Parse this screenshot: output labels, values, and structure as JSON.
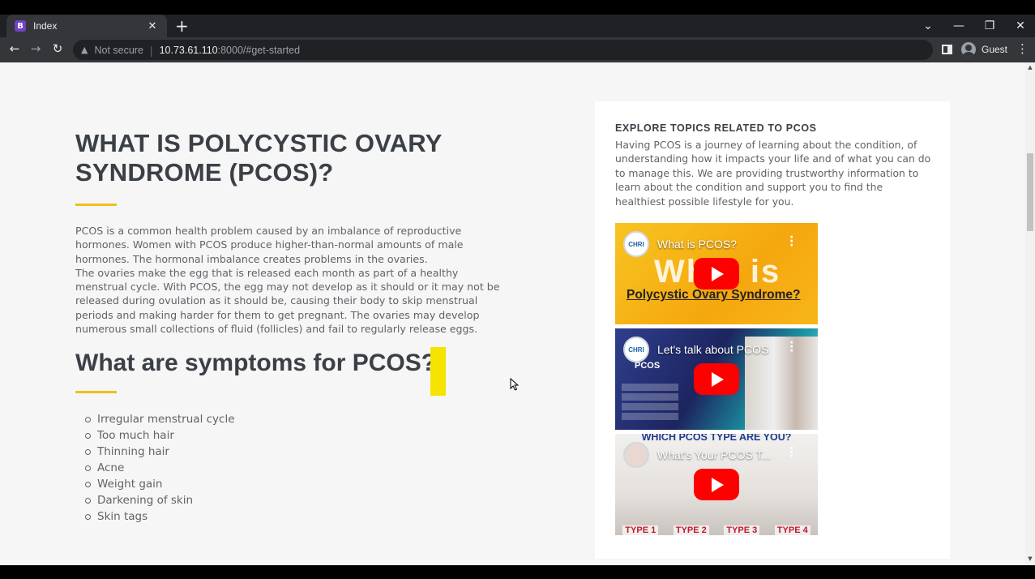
{
  "browser": {
    "tab_favicon": "B",
    "tab_title": "Index",
    "tab_close": "✕",
    "new_tab": "+",
    "security_label": "Not secure",
    "url_host": "10.73.61.110",
    "url_rest": ":8000/#get-started",
    "profile_name": "Guest",
    "icons": [
      "back-icon",
      "forward-icon",
      "reload-icon",
      "warning-icon",
      "side-panel-icon",
      "menu-icon",
      "tab-search-icon",
      "minimize-icon",
      "restore-icon",
      "close-icon"
    ]
  },
  "main": {
    "heading": "WHAT IS POLYCYSTIC OVARY SYNDROME (PCOS)?",
    "intro_p1": "PCOS is a common health problem caused by an imbalance of reproductive hormones. Women with PCOS produce higher-than-normal amounts of male hormones. The hormonal imbalance creates problems in the ovaries.",
    "intro_p2": "The ovaries make the egg that is released each month as part of a healthy menstrual cycle. With PCOS, the egg may not develop as it should or it may not be released during ovulation as it should be, causing their body to skip menstrual periods and making harder for them to get pregnant. The ovaries may develop numerous small collections of fluid (follicles) and fail to regularly release eggs.",
    "symptoms_heading": "What are symptoms for PCOS?",
    "symptoms": [
      "Irregular menstrual cycle",
      "Too much hair",
      "Thinning hair",
      "Acne",
      "Weight gain",
      "Darkening of skin",
      "Skin tags"
    ]
  },
  "sidebar": {
    "title": "EXPLORE TOPICS RELATED TO PCOS",
    "text": "Having PCOS is a journey of learning about the condition, of understanding how it impacts your life and of what you can do to manage this. We are providing trustworthy information to learn about the condition and support you to find the healthiest possible lifestyle for you.",
    "videos": [
      {
        "title": "What is PCOS?",
        "channel": "CHRI",
        "overlay_big": "What is",
        "overlay_sub": "Polycystic Ovary Syndrome?"
      },
      {
        "title": "Let's talk about PCOS",
        "channel": "CHRI",
        "overlay_big": "PCOS"
      },
      {
        "title": "What's Your PCOS T...",
        "overlay_big": "WHICH PCOS TYPE ARE YOU?",
        "types": [
          "TYPE 1",
          "TYPE 2",
          "TYPE 3",
          "TYPE 4"
        ]
      }
    ]
  },
  "colors": {
    "accent": "#f0bf1a",
    "heading": "#3b4047",
    "body_text": "#5f6368",
    "highlight_block": "#f4e400",
    "youtube_red": "#ff0000"
  }
}
